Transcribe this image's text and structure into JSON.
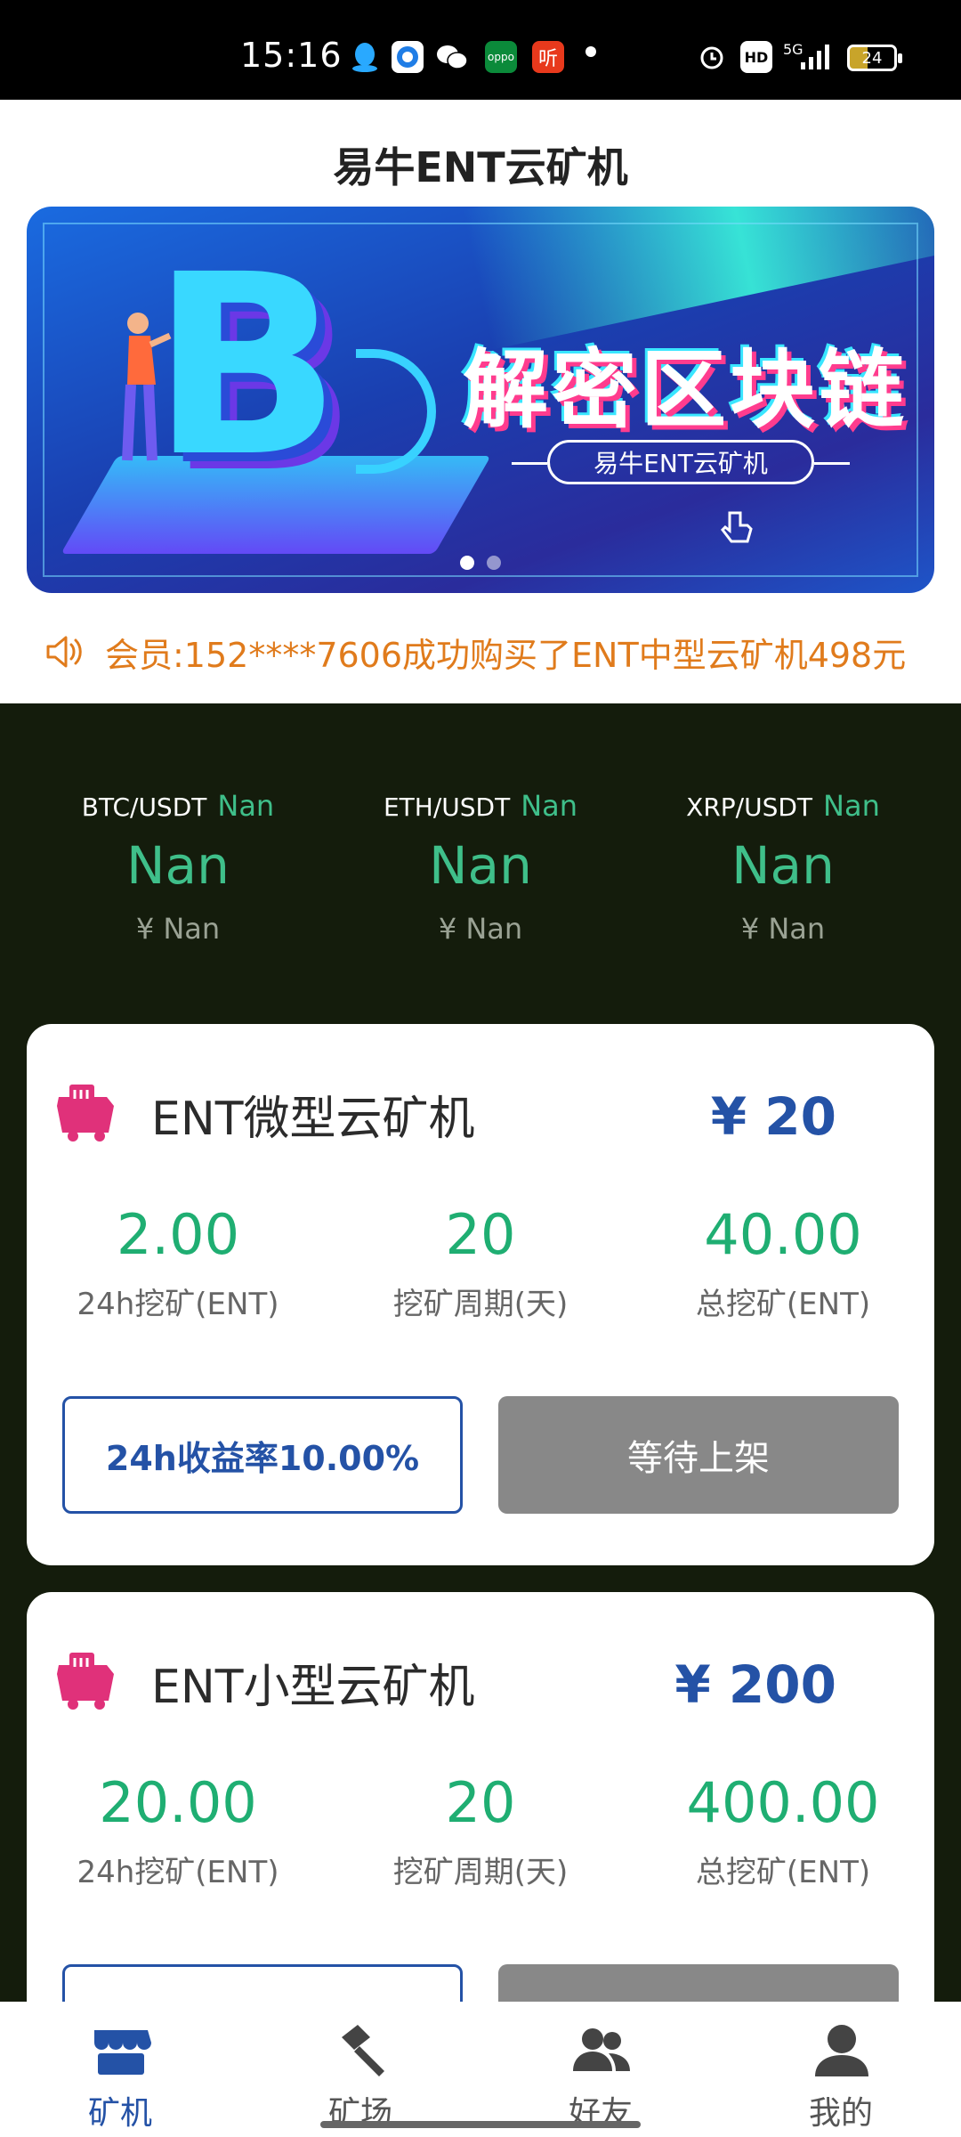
{
  "status_bar": {
    "time": "15:16",
    "notification_icons": [
      "qq-icon",
      "browser-icon",
      "wechat-icon",
      "oppo-icon",
      "ting-icon"
    ],
    "oppo_label": "oppo",
    "ting_label": "听",
    "hd_label": "HD",
    "network_label": "5G",
    "battery_level": "24"
  },
  "header": {
    "title": "易牛ENT云矿机"
  },
  "banner": {
    "headline": "解密区块链",
    "subtitle": "易牛ENT云矿机",
    "slides_total": 2,
    "active_slide": 1
  },
  "notice": {
    "text": "会员:152****7606成功购买了ENT中型云矿机498元"
  },
  "ticker": [
    {
      "pair": "BTC/USDT",
      "change": "Nan",
      "price": "Nan",
      "cny": "¥ Nan"
    },
    {
      "pair": "ETH/USDT",
      "change": "Nan",
      "price": "Nan",
      "cny": "¥ Nan"
    },
    {
      "pair": "XRP/USDT",
      "change": "Nan",
      "price": "Nan",
      "cny": "¥ Nan"
    }
  ],
  "machines": [
    {
      "name": "ENT微型云矿机",
      "price": "¥ 20",
      "stats": [
        {
          "value": "2.00",
          "label": "24h挖矿(ENT)"
        },
        {
          "value": "20",
          "label": "挖矿周期(天)"
        },
        {
          "value": "40.00",
          "label": "总挖矿(ENT)"
        }
      ],
      "rate_label": "24h收益率10.00%",
      "status_label": "等待上架"
    },
    {
      "name": "ENT小型云矿机",
      "price": "¥ 200",
      "stats": [
        {
          "value": "20.00",
          "label": "24h挖矿(ENT)"
        },
        {
          "value": "20",
          "label": "挖矿周期(天)"
        },
        {
          "value": "400.00",
          "label": "总挖矿(ENT)"
        }
      ]
    }
  ],
  "bottom_nav": [
    {
      "label": "矿机",
      "icon": "store-icon",
      "active": true
    },
    {
      "label": "矿场",
      "icon": "hammer-icon",
      "active": false
    },
    {
      "label": "好友",
      "icon": "friends-icon",
      "active": false
    },
    {
      "label": "我的",
      "icon": "profile-icon",
      "active": false
    }
  ],
  "colors": {
    "accent_blue": "#2452a6",
    "green_value": "#1fae72",
    "ticker_green": "#3fbf8a",
    "notice_orange": "#e07b1c",
    "dark_bg": "#141c0c",
    "disabled_gray": "#888888",
    "mining_icon_pink": "#e0317a"
  }
}
